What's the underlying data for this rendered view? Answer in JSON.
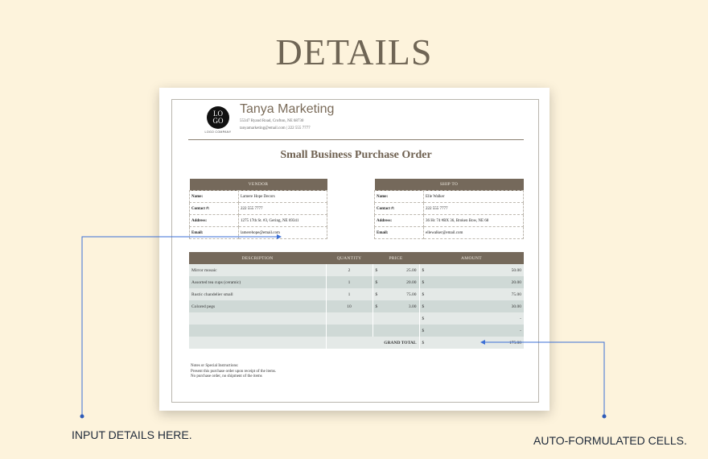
{
  "heading": "DETAILS",
  "logo": {
    "line1": "LO",
    "line2": "GO",
    "subtitle": "LOGO COMPANY"
  },
  "company": {
    "name": "Tanya Marketing",
    "address": "55347 Ryand Road, Crofton, NE 68730",
    "contact": "tanyamarketing@email.com | 222 555 7777"
  },
  "title": "Small Business Purchase Order",
  "vendor": {
    "header": "VENDOR",
    "rows": [
      {
        "label": "Name:",
        "value": "Lamere Hope Decors"
      },
      {
        "label": "Contact #:",
        "value": "222 555 7777"
      },
      {
        "label": "Address:",
        "value": "1275 17th St. #3, Gering, NE 69341"
      },
      {
        "label": "Email:",
        "value": "lamerehope@email.com"
      }
    ]
  },
  "ship_to": {
    "header": "SHIP TO",
    "rows": [
      {
        "label": "Name:",
        "value": "Elle Walker"
      },
      {
        "label": "Contact #:",
        "value": "222 555 7777"
      },
      {
        "label": "Address:",
        "value": "36 Hc 74 #BX 36, Broken Bow, NE 68"
      },
      {
        "label": "Email:",
        "value": "ellewalker@email.com"
      }
    ]
  },
  "items": {
    "headers": [
      "DESCRIPTION",
      "QUANTITY",
      "PRICE",
      "AMOUNT"
    ],
    "currency": "$",
    "rows": [
      {
        "description": "Mirror mosaic",
        "quantity": "2",
        "price": "25.00",
        "amount": "50.00"
      },
      {
        "description": "Assorted tea cups (ceramic)",
        "quantity": "1",
        "price": "20.00",
        "amount": "20.00"
      },
      {
        "description": "Rustic chandelier small",
        "quantity": "1",
        "price": "75.00",
        "amount": "75.00"
      },
      {
        "description": "Colored pegs",
        "quantity": "10",
        "price": "3.00",
        "amount": "30.00"
      },
      {
        "description": "",
        "quantity": "",
        "price": "",
        "amount": "-"
      },
      {
        "description": "",
        "quantity": "",
        "price": "",
        "amount": "-"
      }
    ],
    "grand_total_label": "GRAND TOTAL",
    "grand_total": "175.00"
  },
  "notes": [
    "Notes or Special Instructions:",
    "Present this purchase order upon receipt of the items.",
    "No purchase order, no shipment of the items"
  ],
  "callouts": {
    "left": "INPUT DETAILS HERE.",
    "right": "AUTO-FORMULATED CELLS.",
    "line_color": "#3b6fd6"
  },
  "colors": {
    "background": "#fdf3dc",
    "header_fill": "#75695b",
    "row_light": "#e4e9e7",
    "row_dark": "#cfd9d6"
  }
}
